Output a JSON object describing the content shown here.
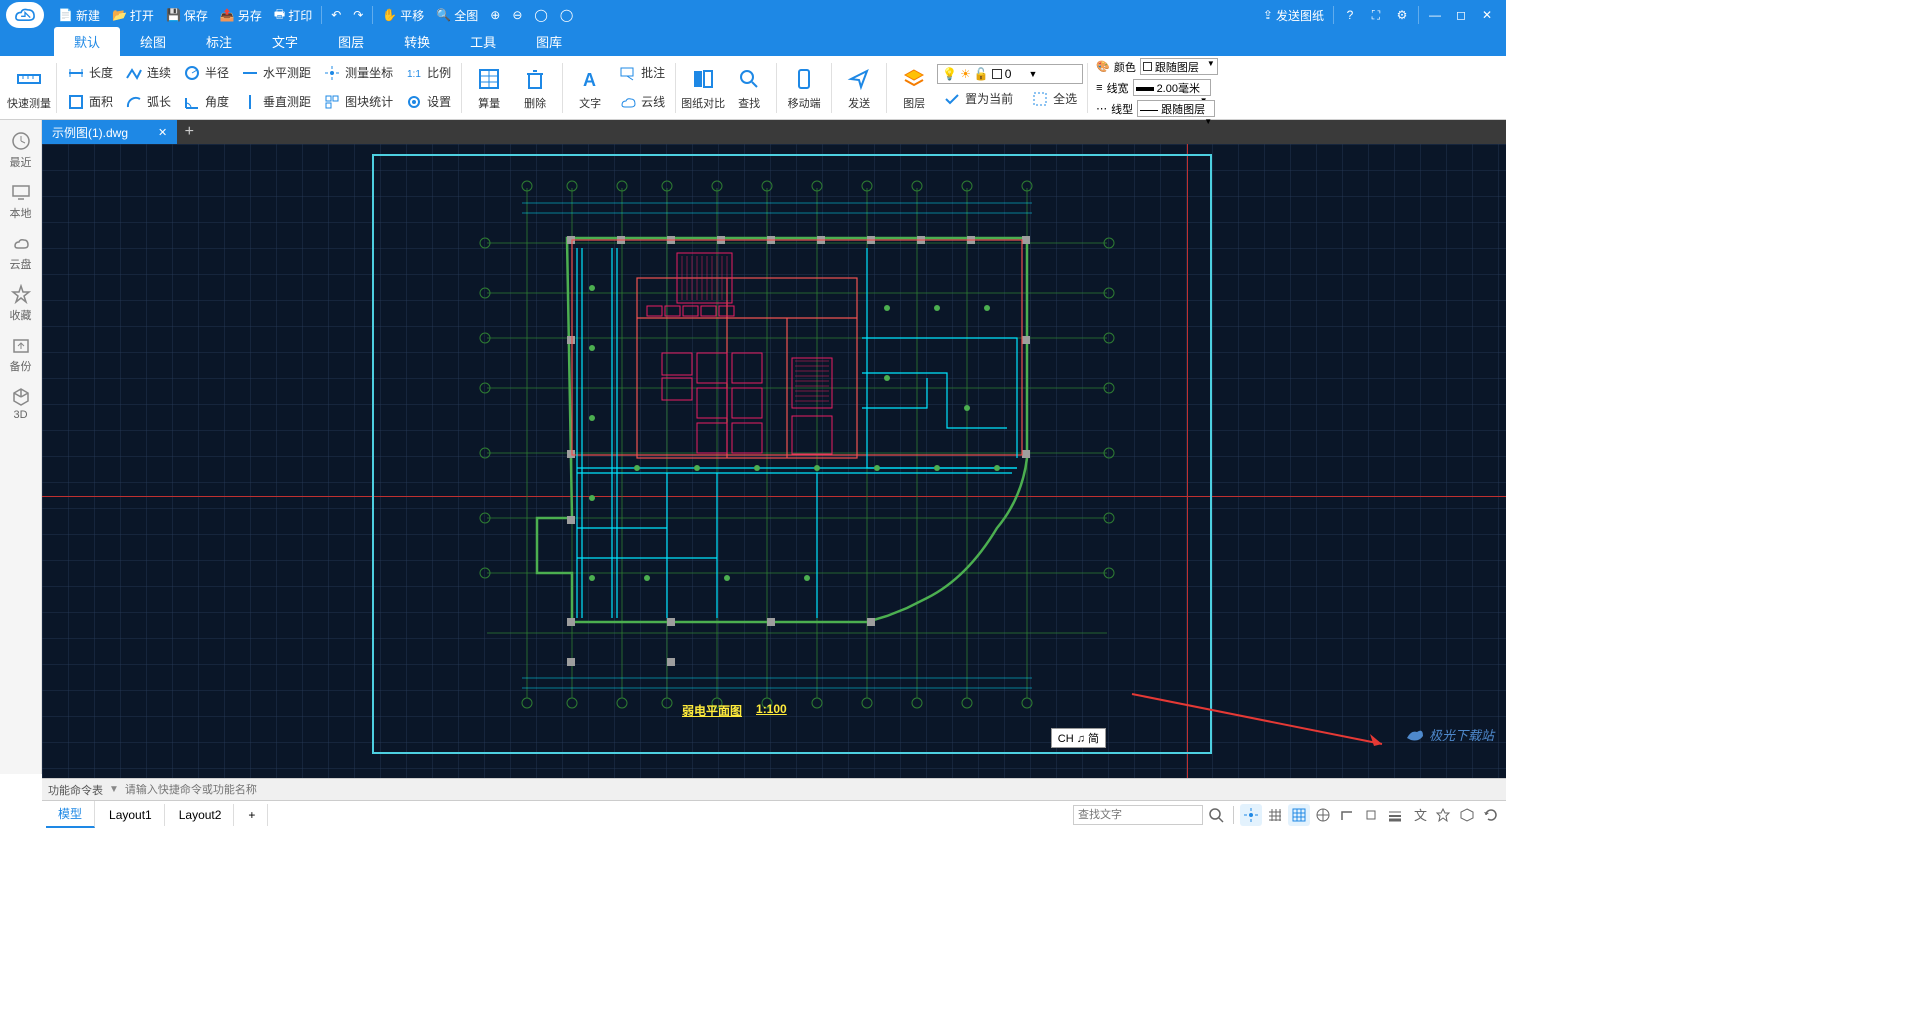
{
  "titlebar": {
    "new": "新建",
    "open": "打开",
    "save": "保存",
    "saveas": "另存",
    "print": "打印",
    "pan": "平移",
    "fit": "全图",
    "send": "发送图纸"
  },
  "menu": {
    "tabs": [
      "默认",
      "绘图",
      "标注",
      "文字",
      "图层",
      "转换",
      "工具",
      "图库"
    ],
    "activeIndex": 0
  },
  "ribbon": {
    "quickmeasure": "快速测量",
    "length": "长度",
    "continuous": "连续",
    "radius": "半径",
    "hdist": "水平测距",
    "coord": "测量坐标",
    "scale": "比例",
    "area": "面积",
    "arc": "弧长",
    "angle": "角度",
    "vdist": "垂直测距",
    "blockstat": "图块统计",
    "settings": "设置",
    "calc": "算量",
    "delete": "删除",
    "text": "文字",
    "annotate": "批注",
    "cloud": "云线",
    "compare": "图纸对比",
    "find": "查找",
    "mobile": "移动端",
    "send": "发送",
    "layer": "图层",
    "setcurrent": "置为当前",
    "selectall": "全选",
    "color_lbl": "颜色",
    "color_val": "跟随图层",
    "lineweight_lbl": "线宽",
    "lineweight_val": "2.00毫米",
    "linetype_lbl": "线型",
    "linetype_val": "跟随图层",
    "layer_num": "0"
  },
  "doctab": {
    "name": "示例图(1).dwg"
  },
  "leftbar": {
    "items": [
      {
        "label": "最近"
      },
      {
        "label": "本地"
      },
      {
        "label": "云盘"
      },
      {
        "label": "收藏"
      },
      {
        "label": "备份"
      },
      {
        "label": "3D"
      }
    ]
  },
  "drawing": {
    "title": "弱电平面图",
    "scale": "1:100"
  },
  "cmdbar": {
    "label": "功能命令表",
    "placeholder": "请输入快捷命令或功能名称"
  },
  "statusbar": {
    "tabs": [
      "模型",
      "Layout1",
      "Layout2"
    ],
    "activeIndex": 0,
    "search_placeholder": "查找文字",
    "ime": "CH ♫ 简"
  },
  "watermark": "极光下载站"
}
